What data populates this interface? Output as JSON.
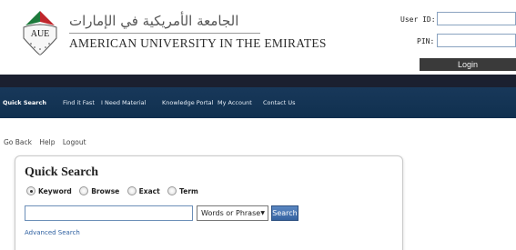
{
  "header": {
    "arabic_name": "الجامعة الأمريكية في الإمارات",
    "english_name": "AMERICAN UNIVERSITY IN THE EMIRATES",
    "logo_text": "AUE"
  },
  "login": {
    "user_id_label": "User ID:",
    "pin_label": "PIN:",
    "button_label": "Login"
  },
  "nav": {
    "items": [
      "Quick Search",
      "Find it Fast",
      "I Need Material",
      "Knowledge Portal",
      "My Account",
      "Contact Us"
    ]
  },
  "utils": [
    "Go Back",
    "Help",
    "Logout"
  ],
  "quick_search": {
    "title": "Quick Search",
    "radios": [
      {
        "label": "Keyword",
        "selected": true
      },
      {
        "label": "Browse",
        "selected": false
      },
      {
        "label": "Exact",
        "selected": false
      },
      {
        "label": "Term",
        "selected": false
      }
    ],
    "select_value": "Words or Phrase",
    "search_button": "Search",
    "advanced_link": "Advanced Search"
  },
  "colors": {
    "nav_background": "#10304f",
    "nav_top_strip": "#1b2030",
    "login_button": "#3a3a3a",
    "search_button": "#3562a0",
    "link": "#2d5fa0",
    "logo_red": "#c0262c",
    "logo_green": "#1e7a3c"
  }
}
